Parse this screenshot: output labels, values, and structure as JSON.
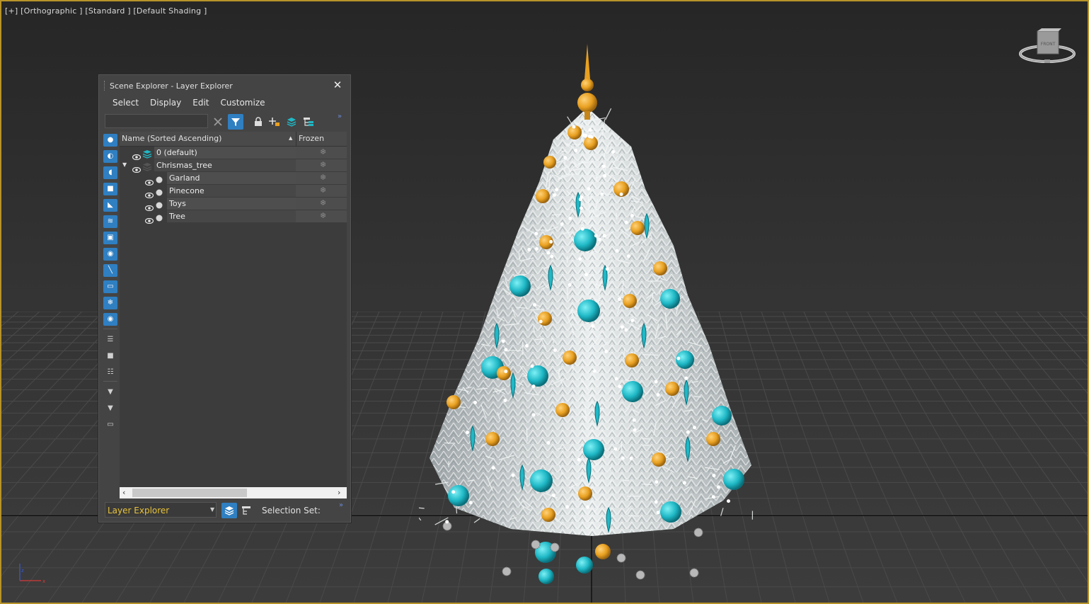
{
  "viewport": {
    "label": "[+] [Orthographic ] [Standard ] [Default Shading ]",
    "viewcube_label": "FRONT"
  },
  "explorer": {
    "title": "Scene Explorer - Layer Explorer",
    "menu": [
      "Select",
      "Display",
      "Edit",
      "Customize"
    ],
    "search_value": "",
    "columns": {
      "name": "Name (Sorted Ascending)",
      "frozen": "Frozen"
    },
    "layers": [
      {
        "name": "0 (default)",
        "level": 0,
        "expanded": null,
        "type": "layer-active"
      },
      {
        "name": "Chrismas_tree",
        "level": 0,
        "expanded": true,
        "type": "layer"
      },
      {
        "name": "Garland",
        "level": 1,
        "expanded": null,
        "type": "object"
      },
      {
        "name": "Pinecone",
        "level": 1,
        "expanded": null,
        "type": "object"
      },
      {
        "name": "Toys",
        "level": 1,
        "expanded": null,
        "type": "object"
      },
      {
        "name": "Tree",
        "level": 1,
        "expanded": null,
        "type": "object"
      }
    ],
    "frozen_icon": "snowflake-icon",
    "explorer_type": "Layer Explorer",
    "selection_set_label": "Selection Set:"
  },
  "colors": {
    "accent": "#2f7fc1",
    "viewport_border": "#b8932b",
    "explorer_type_text": "#e8c23a",
    "ornament_teal": "#1fb8c6",
    "ornament_gold": "#e8a020"
  }
}
